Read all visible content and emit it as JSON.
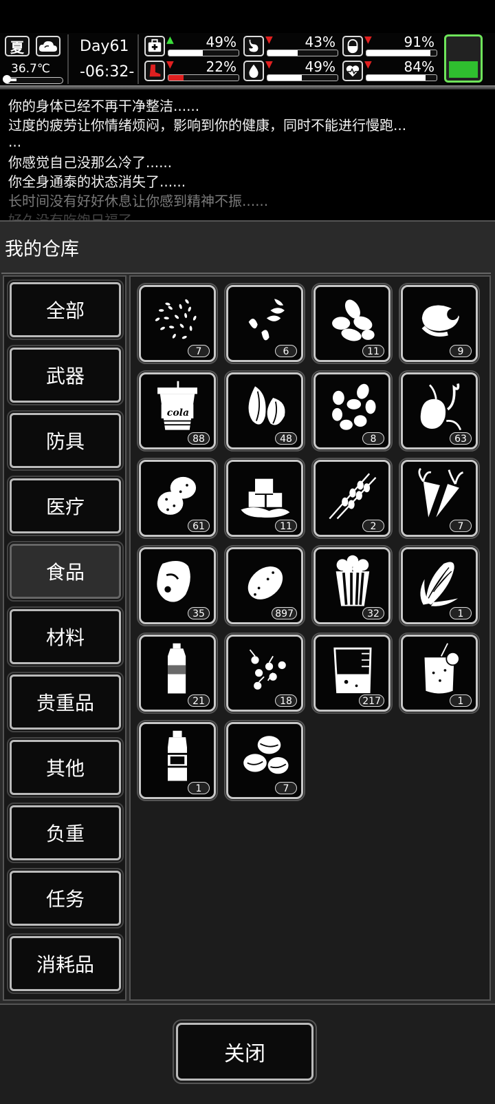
{
  "hud": {
    "season": "夏",
    "weather_icon": "cloud-icon",
    "temperature": "36.7℃",
    "day": "Day61",
    "time": "-06:32-",
    "stats": [
      {
        "icon": "medkit-icon",
        "trend": "up",
        "percent": "49%",
        "level": 0.49,
        "bar_color": "#ffffff"
      },
      {
        "icon": "stomach-icon",
        "trend": "down",
        "percent": "43%",
        "level": 0.43,
        "bar_color": "#ffffff"
      },
      {
        "icon": "pill-icon",
        "trend": "down",
        "percent": "91%",
        "level": 0.91,
        "bar_color": "#ffffff"
      },
      {
        "icon": "boot-icon",
        "trend": "down",
        "percent": "22%",
        "level": 0.22,
        "bar_color": "#e02020"
      },
      {
        "icon": "water-drop-icon",
        "trend": "down",
        "percent": "49%",
        "level": 0.49,
        "bar_color": "#ffffff"
      },
      {
        "icon": "heart-icon",
        "trend": "down",
        "percent": "84%",
        "level": 0.84,
        "bar_color": "#ffffff"
      }
    ],
    "battery_color": "#2fbf2f"
  },
  "log": [
    "你的身体已经不再干净整洁......",
    "过度的疲劳让你情绪烦闷，影响到你的健康，同时不能进行慢跑...",
    "...",
    "你感觉自己没那么冷了......",
    "你全身通泰的状态消失了......",
    "长时间没有好好休息让你感到精神不振......",
    "好久没有吃饱日福了"
  ],
  "panel": {
    "title": "我的仓库",
    "categories": [
      "全部",
      "武器",
      "防具",
      "医疗",
      "食品",
      "材料",
      "贵重品",
      "其他",
      "负重",
      "任务",
      "消耗品"
    ],
    "active_category": "食品",
    "close_label": "关闭"
  },
  "items": [
    {
      "icon": "seeds-icon",
      "count": "7"
    },
    {
      "icon": "sunflower-seeds-icon",
      "count": "6"
    },
    {
      "icon": "almonds-icon",
      "count": "11"
    },
    {
      "icon": "egg-icon",
      "count": "9"
    },
    {
      "icon": "cola-cup-icon",
      "count": "88",
      "label": "cola"
    },
    {
      "icon": "pistachio-icon",
      "count": "48"
    },
    {
      "icon": "beans-icon",
      "count": "8"
    },
    {
      "icon": "sweet-potato-icon",
      "count": "63"
    },
    {
      "icon": "potatoes-icon",
      "count": "61"
    },
    {
      "icon": "tofu-icon",
      "count": "11"
    },
    {
      "icon": "skewer-icon",
      "count": "2"
    },
    {
      "icon": "carrot-icon",
      "count": "7"
    },
    {
      "icon": "meat-icon",
      "count": "35"
    },
    {
      "icon": "potato-icon",
      "count": "897"
    },
    {
      "icon": "popcorn-icon",
      "count": "32"
    },
    {
      "icon": "corn-icon",
      "count": "1"
    },
    {
      "icon": "water-bottle-icon",
      "count": "21"
    },
    {
      "icon": "berries-icon",
      "count": "18"
    },
    {
      "icon": "beaker-icon",
      "count": "217"
    },
    {
      "icon": "juice-icon",
      "count": "1"
    },
    {
      "icon": "sauce-bottle-icon",
      "count": "1"
    },
    {
      "icon": "coffee-beans-icon",
      "count": "7"
    }
  ]
}
